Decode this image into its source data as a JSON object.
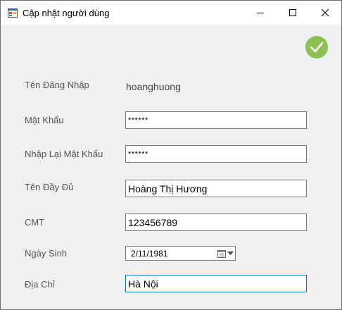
{
  "window": {
    "title": "Cập nhật người dùng"
  },
  "form": {
    "username_label": "Tên Đăng Nhập",
    "username_value": "hoanghuong",
    "password_label": "Mật Khẩu",
    "password_value": "******",
    "confirm_password_label": "Nhập Lại Mật Khẩu",
    "confirm_password_value": "******",
    "fullname_label": "Tên Đầy Đủ",
    "fullname_value": "Hoàng Thị Hương",
    "id_label": "CMT",
    "id_value": "123456789",
    "birthdate_label": "Ngày Sinh",
    "birthdate_value": "2/11/1981",
    "address_label": "Địa Chỉ",
    "address_value": "Hà Nội"
  },
  "icons": {
    "app": "app-window-icon",
    "minimize": "minimize-icon",
    "maximize": "maximize-icon",
    "close": "close-icon",
    "confirm": "check-circle-icon",
    "calendar": "calendar-icon",
    "dropdown": "chevron-down-icon"
  },
  "colors": {
    "confirm_badge": "#8cc152",
    "focus_border": "#0078d7"
  }
}
